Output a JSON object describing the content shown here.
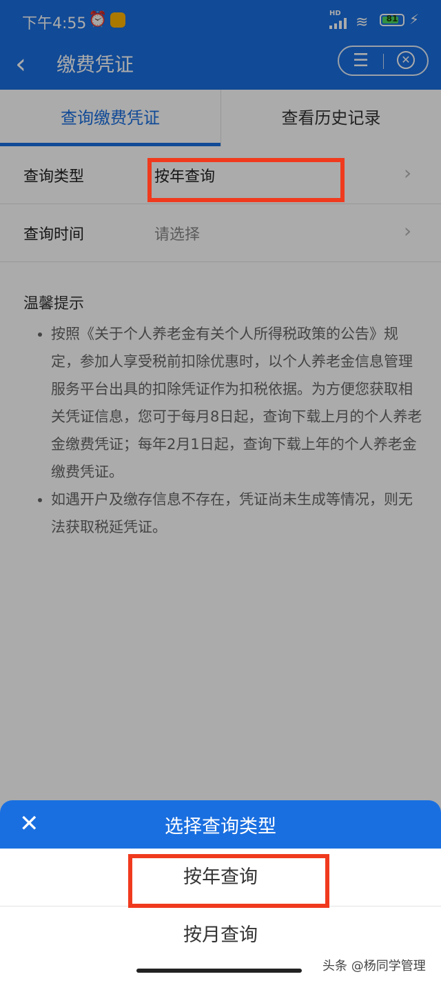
{
  "status_bar": {
    "time": "下午4:55",
    "network": "HD",
    "battery": "81",
    "battery_fraction": 0.81
  },
  "header": {
    "title": "缴费凭证",
    "back_icon": "chevron-left-icon",
    "menu_icon": "menu-icon",
    "close_icon": "close-circle-icon"
  },
  "tabs": [
    {
      "label": "查询缴费凭证",
      "active": true
    },
    {
      "label": "查看历史记录",
      "active": false
    }
  ],
  "form": {
    "rows": [
      {
        "label": "查询类型",
        "value": "按年查询"
      },
      {
        "label": "查询时间",
        "value": "请选择"
      }
    ]
  },
  "tips": {
    "heading": "温馨提示",
    "items": [
      "按照《关于个人养老金有关个人所得税政策的公告》规定，参加人享受税前扣除优惠时，以个人养老金信息管理服务平台出具的扣除凭证作为扣税依据。为方便您获取相关凭证信息，您可于每月8日起，查询下载上月的个人养老金缴费凭证；每年2月1日起，查询下载上年的个人养老金缴费凭证。",
      "如遇开户及缴存信息不存在，凭证尚未生成等情况，则无法获取税延凭证。"
    ]
  },
  "sheet": {
    "title": "选择查询类型",
    "options": [
      "按年查询",
      "按月查询"
    ]
  },
  "watermark": "头条 @杨同学管理",
  "colors": {
    "primary": "#1a6fe0",
    "highlight": "#f03a1e"
  }
}
